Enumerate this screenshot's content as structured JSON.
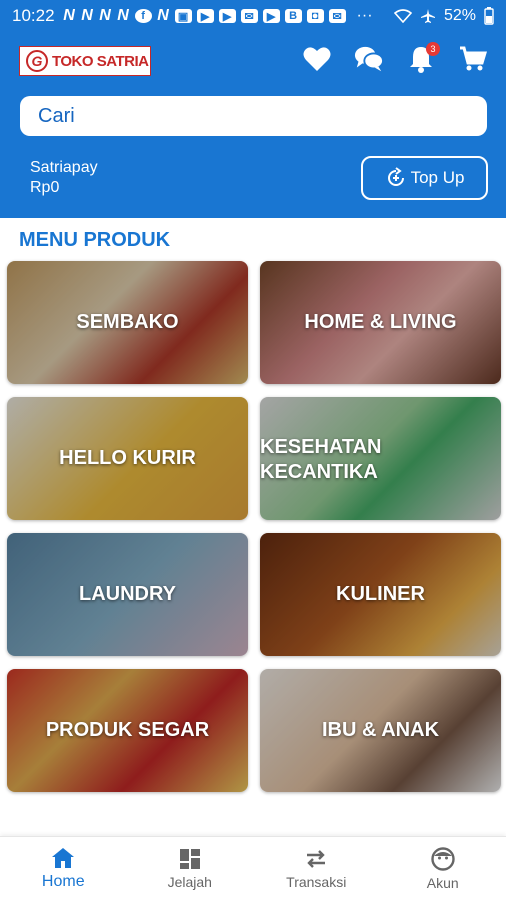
{
  "status_bar": {
    "time": "10:22",
    "battery": "52%",
    "more": "···",
    "app_icons": [
      "N",
      "N",
      "N",
      "N",
      "facebook-icon",
      "N",
      "image-icon",
      "youtube-icon",
      "youtube-icon",
      "mail-icon",
      "youtube-icon",
      "blue-app-icon",
      "bag-icon",
      "mail-outline-icon"
    ]
  },
  "header": {
    "logo_text": "TOKO SATRIA",
    "notification_count": "3",
    "search_placeholder": "Cari",
    "wallet_name": "Satriapay",
    "wallet_balance": "Rp0",
    "topup_label": "Top Up"
  },
  "menu": {
    "title": "MENU PRODUK",
    "items": [
      {
        "label": "SEMBAKO"
      },
      {
        "label": "HOME & LIVING"
      },
      {
        "label": "HELLO KURIR"
      },
      {
        "label_line1": "KESEHATAN",
        "label_line2": "KECANTIKA"
      },
      {
        "label": "LAUNDRY"
      },
      {
        "label": "KULINER"
      },
      {
        "label": "PRODUK SEGAR"
      },
      {
        "label": "IBU & ANAK"
      }
    ]
  },
  "bottom_nav": {
    "items": [
      {
        "label": "Home"
      },
      {
        "label": "Jelajah"
      },
      {
        "label": "Transaksi"
      },
      {
        "label": "Akun"
      }
    ]
  },
  "colors": {
    "primary": "#1976d2",
    "badge": "#e53935",
    "logo_red": "#c62828"
  }
}
